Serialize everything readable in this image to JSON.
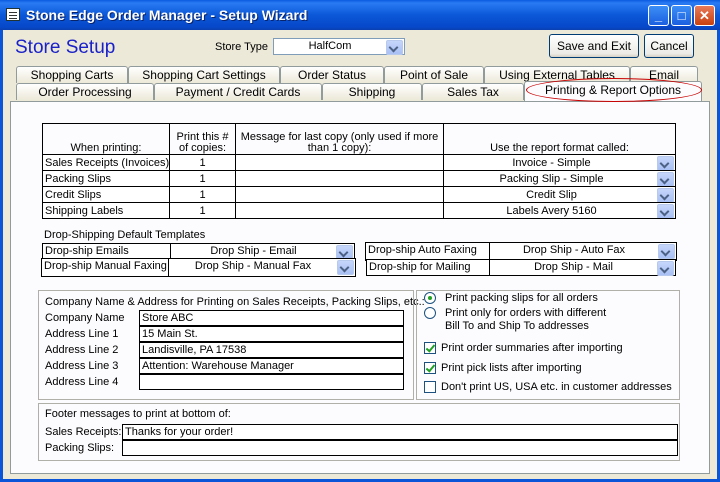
{
  "window": {
    "title": "Stone Edge Order Manager - Setup Wizard",
    "min": "_",
    "max": "□",
    "close": "✕"
  },
  "header": {
    "title": "Store Setup",
    "store_type_label": "Store Type",
    "store_type_value": "HalfCom",
    "save_exit": "Save and Exit",
    "cancel": "Cancel"
  },
  "tabs_row1": [
    "Shopping Carts",
    "Shopping Cart Settings",
    "Order Status",
    "Point of Sale",
    "Using External Tables",
    "Email"
  ],
  "tabs_row2": [
    "Order Processing",
    "Payment / Credit Cards",
    "Shipping",
    "Sales Tax",
    "Printing & Report Options"
  ],
  "printing": {
    "col_when": "When printing:",
    "col_copies": "Print this # of copies:",
    "col_message": "Message for last copy (only used if more than 1 copy):",
    "col_format": "Use the report format called:",
    "rows": [
      {
        "label": "Sales Receipts (Invoices)",
        "copies": "1",
        "message": "",
        "format": "Invoice - Simple"
      },
      {
        "label": "Packing Slips",
        "copies": "1",
        "message": "",
        "format": "Packing Slip - Simple"
      },
      {
        "label": "Credit Slips",
        "copies": "1",
        "message": "",
        "format": "Credit Slip"
      },
      {
        "label": "Shipping Labels",
        "copies": "1",
        "message": "",
        "format": "Labels Avery 5160"
      }
    ]
  },
  "dropship": {
    "heading": "Drop-Shipping Default Templates",
    "emails_label": "Drop-ship Emails",
    "emails_value": "Drop Ship - Email",
    "manual_fax_label": "Drop-ship Manual Faxing",
    "manual_fax_value": "Drop Ship - Manual Fax",
    "auto_fax_label": "Drop-ship Auto Faxing",
    "auto_fax_value": "Drop Ship - Auto Fax",
    "mailing_label": "Drop-ship for Mailing",
    "mailing_value": "Drop Ship - Mail"
  },
  "company": {
    "heading": "Company Name & Address for Printing on Sales Receipts, Packing Slips, etc.:",
    "fields": [
      {
        "label": "Company Name",
        "value": "Store ABC"
      },
      {
        "label": "Address Line 1",
        "value": "15 Main St."
      },
      {
        "label": "Address Line 2",
        "value": "Landisville, PA 17538"
      },
      {
        "label": "Address Line 3",
        "value": "Attention: Warehouse Manager"
      },
      {
        "label": "Address Line 4",
        "value": ""
      }
    ]
  },
  "options": {
    "radio_all": "Print packing slips for all orders",
    "radio_diff_1": "Print only for orders with different",
    "radio_diff_2": "Bill To and Ship To addresses",
    "chk_summaries": "Print order summaries after importing",
    "chk_picklists": "Print pick lists after importing",
    "chk_no_us": "Don't print US, USA etc. in customer addresses"
  },
  "footer": {
    "heading": "Footer messages to print at bottom of:",
    "sales_label": "Sales Receipts:",
    "sales_value": "Thanks for your order!",
    "packing_label": "Packing Slips:",
    "packing_value": ""
  }
}
